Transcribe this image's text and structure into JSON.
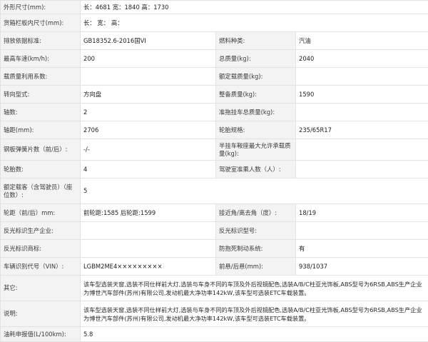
{
  "rows": [
    {
      "l1": "外形尺寸(mm):",
      "wide": "长：4681 宽：1840 高：1730"
    },
    {
      "l1": "货箱栏板内尺寸(mm):",
      "wide": "长：   宽：   高："
    },
    {
      "l1": "排放依据标准:",
      "v1": "GB18352.6-2016国VI",
      "l2": "燃料种类:",
      "v2": "汽油"
    },
    {
      "l1": "最高车速(km/h):",
      "v1": "200",
      "l2": "总质量(kg):",
      "v2": "2040"
    },
    {
      "l1": "载质量利用系数:",
      "v1": "",
      "l2": "额定载质量(kg):",
      "v2": ""
    },
    {
      "l1": "转向型式:",
      "v1": "方向盘",
      "l2": "整备质量(kg):",
      "v2": "1590"
    },
    {
      "l1": "轴数:",
      "v1": "2",
      "l2": "准拖挂车总质量(kg):",
      "v2": ""
    },
    {
      "l1": "轴距(mm):",
      "v1": "2706",
      "l2": "轮胎规格:",
      "v2": "235/65R17"
    },
    {
      "l1": "钢板弹簧片数（前/后）:",
      "v1": "-/-",
      "l2": "半挂车鞍座最大允许承载质量(kg):",
      "v2": ""
    },
    {
      "l1": "轮胎数:",
      "v1": "4",
      "l2": "驾驶室准乘人数（人）:",
      "v2": ""
    },
    {
      "l1": "额定载客（含驾驶员）（座位数）:",
      "wide": "5"
    },
    {
      "l1": "轮距（前/后）mm:",
      "v1": "前轮距:1585 后轮距:1599",
      "l2": "接近角/离去角（度）:",
      "v2": "18/19"
    },
    {
      "l1": "反光标识生产企业:",
      "v1": "",
      "l2": "反光标识型号:",
      "v2": ""
    },
    {
      "l1": "反光标识商标:",
      "v1": "",
      "l2": "防抱死制动系统:",
      "v2": "有"
    },
    {
      "l1": "车辆识别代号（VIN）:",
      "v1": "LGBM2ME4×××××××××",
      "l2": "前悬/后悬(mm):",
      "v2": "938/1037"
    },
    {
      "l1": "其它:",
      "wide": "该车型选装天窗,选装不同仕样前大灯,选装与车身不同的车顶及外后视镜配色,选装A/B/C柱亚光饰板,ABS型号为6RSB,ABS生产企业为博世汽车部件(苏州)有限公司,发动机最大净功率142kW,该车型可选装ETC车载装置。"
    },
    {
      "l1": "说明:",
      "wide": "该车型选装天窗,选装不同仕样前大灯,选装与车身不同的车顶及外后视镜配色,选装A/B/C柱亚光饰板,ABS型号为6RSB,ABS生产企业为博世汽车部件(苏州)有限公司,发动机最大净功率142kW,该车型可选装ETC车载装置。"
    },
    {
      "l1": "油耗申报值(L/100km):",
      "wide": "5.8"
    }
  ]
}
